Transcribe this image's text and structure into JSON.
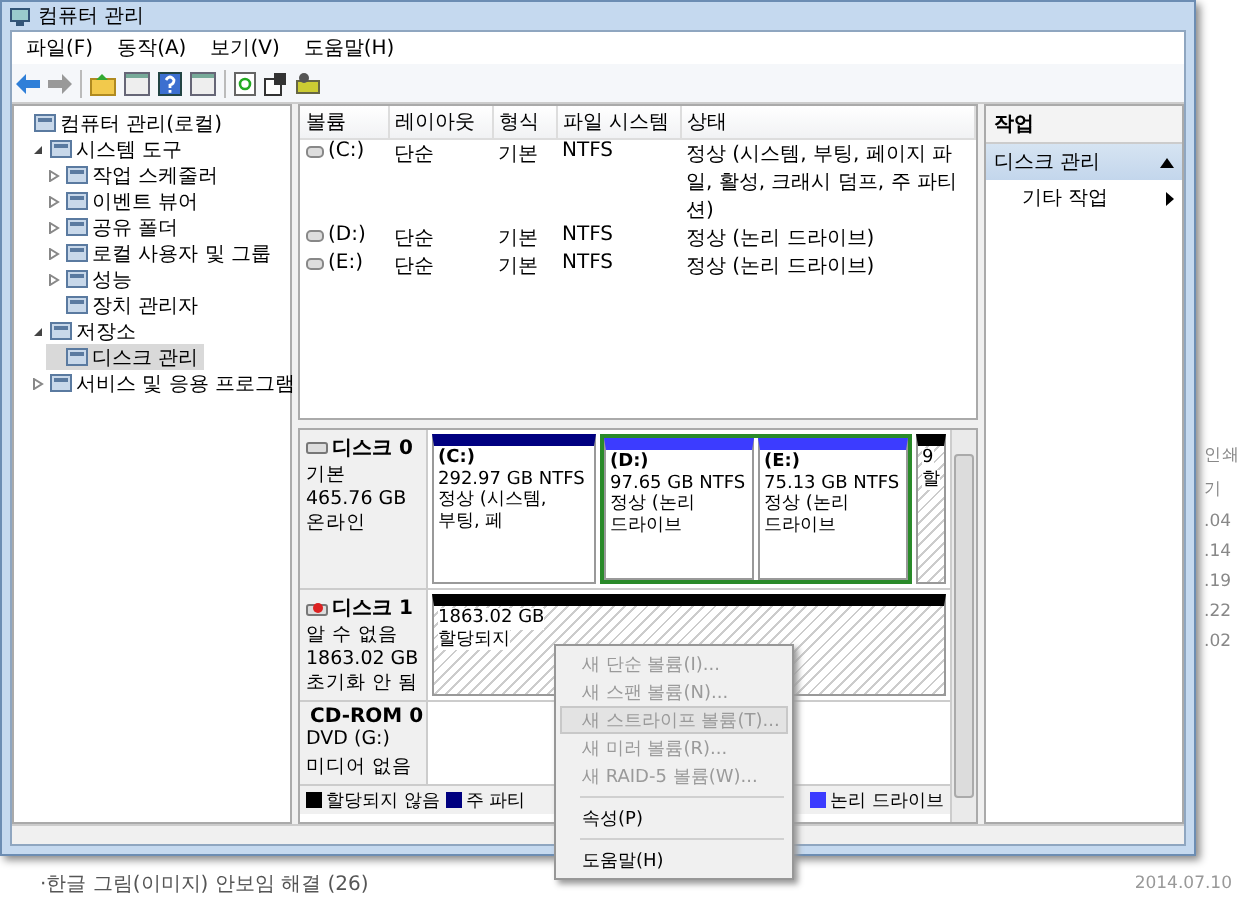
{
  "window": {
    "title": "컴퓨터 관리"
  },
  "menu": [
    "파일(F)",
    "동작(A)",
    "보기(V)",
    "도움말(H)"
  ],
  "tree": [
    {
      "label": "컴퓨터 관리(로컬)",
      "selected": false,
      "children": [
        {
          "label": "시스템 도구",
          "expanded": true,
          "selected": false,
          "children": [
            {
              "label": "작업 스케줄러",
              "expanded": false,
              "selected": false
            },
            {
              "label": "이벤트 뷰어",
              "expanded": false,
              "selected": false
            },
            {
              "label": "공유 폴더",
              "expanded": false,
              "selected": false
            },
            {
              "label": "로컬 사용자 및 그룹",
              "expanded": false,
              "selected": false
            },
            {
              "label": "성능",
              "expanded": false,
              "selected": false
            },
            {
              "label": "장치 관리자",
              "selected": false
            }
          ]
        },
        {
          "label": "저장소",
          "expanded": true,
          "selected": false,
          "children": [
            {
              "label": "디스크 관리",
              "selected": true
            }
          ]
        },
        {
          "label": "서비스 및 응용 프로그램",
          "expanded": false,
          "selected": false
        }
      ]
    }
  ],
  "volumes": {
    "columns": [
      "볼륨",
      "레이아웃",
      "형식",
      "파일 시스템",
      "상태"
    ],
    "rows": [
      [
        "(C:)",
        "단순",
        "기본",
        "NTFS",
        "정상 (시스템, 부팅, 페이지 파일, 활성, 크래시 덤프, 주 파티션)"
      ],
      [
        "(D:)",
        "단순",
        "기본",
        "NTFS",
        "정상 (논리 드라이브)"
      ],
      [
        "(E:)",
        "단순",
        "기본",
        "NTFS",
        "정상 (논리 드라이브)"
      ]
    ]
  },
  "disks": [
    {
      "kind": "disk",
      "name": "디스크 0",
      "details": [
        "기본",
        "465.76 GB",
        "온라인"
      ],
      "partitions": [
        {
          "kind": "primary",
          "lines": [
            "(C:)",
            "292.97 GB NTFS",
            "정상 (시스템, 부팅, 페"
          ]
        },
        {
          "kind": "extended",
          "children": [
            {
              "kind": "logical",
              "lines": [
                "(D:)",
                "97.65 GB NTFS",
                "정상 (논리 드라이브"
              ]
            },
            {
              "kind": "logical",
              "lines": [
                "(E:)",
                "75.13 GB NTFS",
                "정상 (논리 드라이브"
              ]
            }
          ]
        },
        {
          "kind": "unallocated",
          "lines": [
            "9",
            "할"
          ]
        }
      ]
    },
    {
      "kind": "unknown",
      "name": "디스크 1",
      "details": [
        "알 수 없음",
        "1863.02 GB",
        "초기화 안 됨"
      ],
      "partitions": [
        {
          "kind": "unallocated",
          "lines": [
            "1863.02 GB",
            "할당되지"
          ]
        }
      ]
    },
    {
      "kind": "cdrom",
      "name": "CD-ROM 0",
      "details": [
        "DVD (G:)",
        "미디어 없음"
      ]
    }
  ],
  "legend": [
    {
      "label": "할당되지 않음",
      "color": "#000000"
    },
    {
      "label": "주 파티",
      "color": "#000080"
    },
    {
      "label": "논리 드라이브",
      "color": "#3c3cff"
    }
  ],
  "actions": {
    "title": "작업",
    "sections": [
      {
        "label": "디스크 관리",
        "expanded": true,
        "items": [
          "기타 작업"
        ]
      }
    ]
  },
  "context_menu": [
    {
      "kind": "item",
      "label": "새 단순 볼륨(I)...",
      "disabled": true,
      "selected": false
    },
    {
      "kind": "item",
      "label": "새 스팬 볼륨(N)...",
      "disabled": true,
      "selected": false
    },
    {
      "kind": "item",
      "label": "새 스트라이프 볼륨(T)...",
      "disabled": true,
      "selected": true
    },
    {
      "kind": "item",
      "label": "새 미러 볼륨(R)...",
      "disabled": true,
      "selected": false
    },
    {
      "kind": "item",
      "label": "새 RAID-5 볼륨(W)...",
      "disabled": true,
      "selected": false
    },
    {
      "kind": "separator"
    },
    {
      "kind": "item",
      "label": "속성(P)",
      "disabled": false,
      "selected": false
    },
    {
      "kind": "separator"
    },
    {
      "kind": "item",
      "label": "도움말(H)",
      "disabled": false,
      "selected": false
    }
  ],
  "background": {
    "side": [
      "인쇄",
      "기",
      ".04",
      ".14",
      ".19",
      ".22",
      ".02"
    ],
    "footer": "·한글 그림(이미지) 안보임 해결 (26)",
    "date": "2014.07.10"
  }
}
